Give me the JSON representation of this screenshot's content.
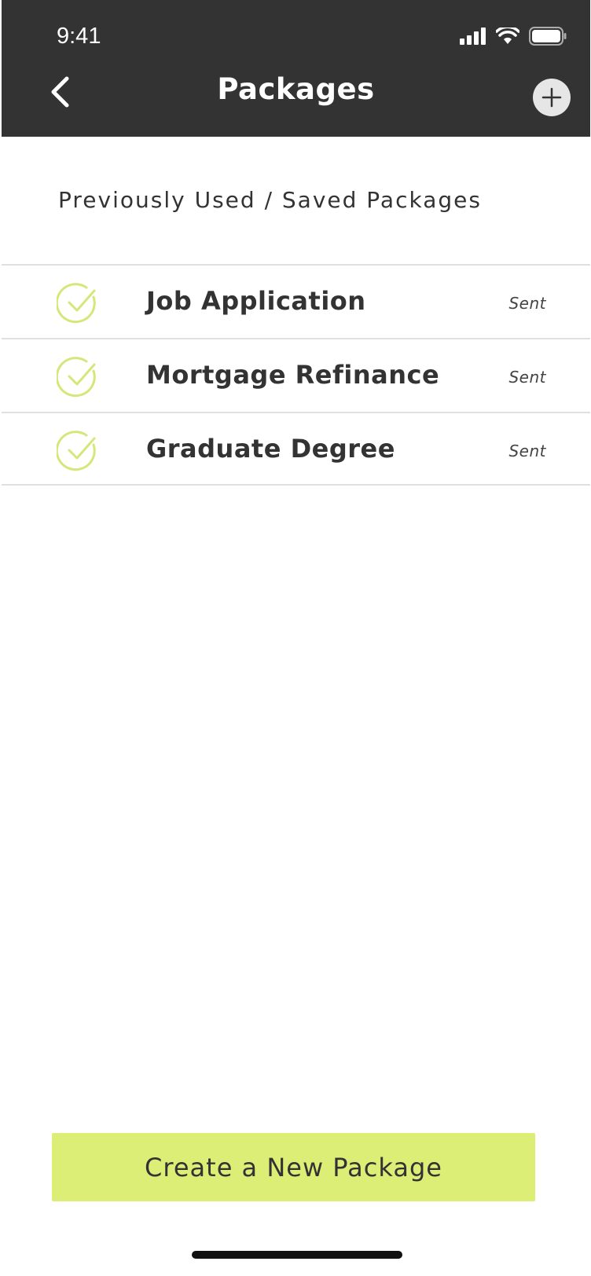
{
  "status_bar": {
    "time": "9:41",
    "icons": [
      "signal-icon",
      "wifi-icon",
      "battery-icon"
    ]
  },
  "header": {
    "title": "Packages",
    "back_icon": "chevron-left-icon",
    "add_icon": "plus-icon"
  },
  "section": {
    "heading": "Previously Used / Saved Packages"
  },
  "packages": [
    {
      "name": "Job Application",
      "status": "Sent",
      "icon": "check-circle-icon"
    },
    {
      "name": "Mortgage Refinance",
      "status": "Sent",
      "icon": "check-circle-icon"
    },
    {
      "name": "Graduate Degree",
      "status": "Sent",
      "icon": "check-circle-icon"
    }
  ],
  "actions": {
    "create_label": "Create a New Package"
  },
  "colors": {
    "header_bg": "#333333",
    "accent": "#ddee77",
    "check": "#d4e87a",
    "text": "#333333"
  }
}
